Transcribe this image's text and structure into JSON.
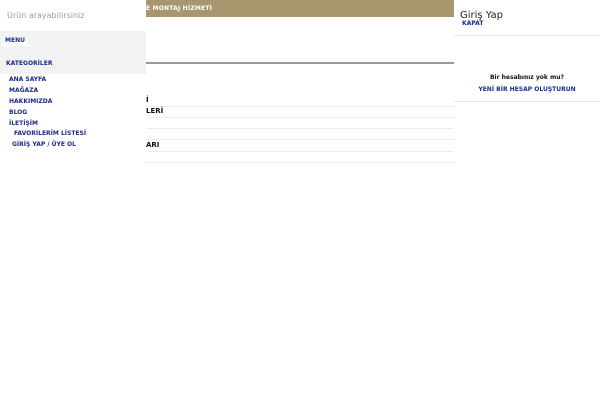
{
  "announcement": {
    "text": "E MONTAJ HİZMETİ"
  },
  "background_rows": [
    {
      "text": "İ"
    },
    {
      "text": "LERİ"
    },
    {
      "text": ""
    },
    {
      "text": ""
    },
    {
      "text": "ARI"
    },
    {
      "text": ""
    }
  ],
  "search": {
    "placeholder": "Ürün arayabilirsiniz"
  },
  "menu_drawer": {
    "tab_menu": "MENU",
    "tab_categories": "KATEGORİLER",
    "items": [
      {
        "label": "ANA SAYFA"
      },
      {
        "label": "MAĞAZA"
      },
      {
        "label": "HAKKIMIZDA"
      },
      {
        "label": "BLOG"
      },
      {
        "label": "İLETİŞİM"
      },
      {
        "label": "FAVORİLERİM LİSTESİ"
      },
      {
        "label": "GİRİŞ YAP / ÜYE OL"
      }
    ]
  },
  "login_drawer": {
    "title": "Giriş Yap",
    "close_label": "KAPAT",
    "no_account_text": "Bir hesabınız yok mu?",
    "create_account_label": "YENİ BİR HESAP OLUŞTURUN"
  },
  "colors": {
    "announcement_bg": "#a8966f",
    "link": "#1a2a8a",
    "menu_tabs_bg": "#f2f2f2"
  }
}
